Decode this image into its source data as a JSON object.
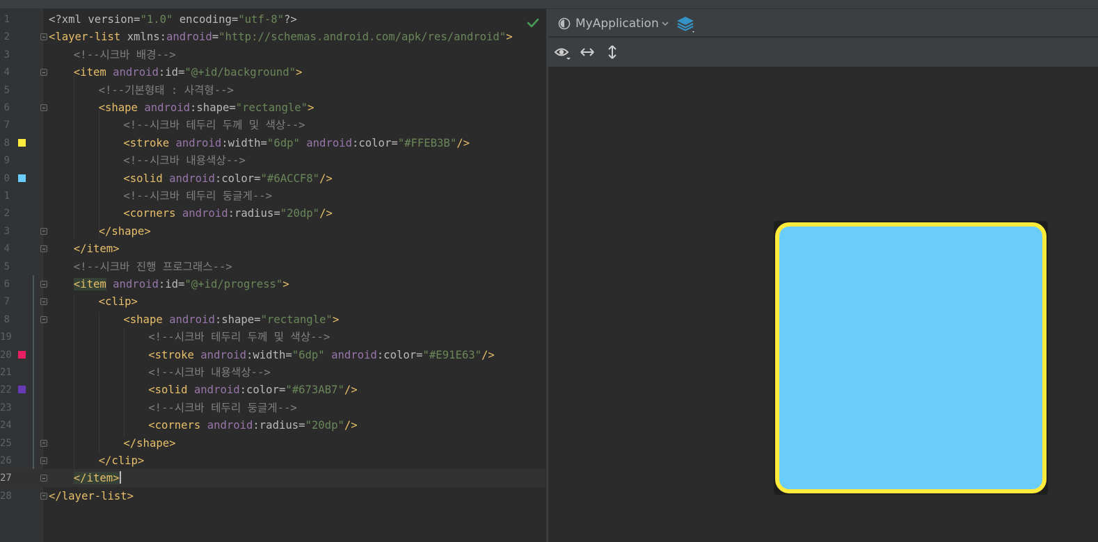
{
  "editor": {
    "lines": [
      {
        "n": "1",
        "tokens": [
          [
            "t-attr",
            "<?xml version="
          ],
          [
            "t-val",
            "\"1.0\""
          ],
          [
            "t-attr",
            " encoding="
          ],
          [
            "t-val",
            "\"utf-8\""
          ],
          [
            "t-attr",
            "?>"
          ]
        ]
      },
      {
        "n": "2",
        "tokens": [
          [
            "t-tag",
            "<layer-list "
          ],
          [
            "t-attr",
            "xmlns:"
          ],
          [
            "t-ns",
            "android"
          ],
          [
            "t-attr",
            "="
          ],
          [
            "t-val",
            "\"http://schemas.android.com/apk/res/android\""
          ],
          [
            "t-tag",
            ">"
          ]
        ]
      },
      {
        "n": "3",
        "tokens": [
          [
            "t-com",
            "<!--시크바 배경-->"
          ]
        ]
      },
      {
        "n": "4",
        "tokens": [
          [
            "t-tag",
            "<item "
          ],
          [
            "t-ns",
            "android"
          ],
          [
            "t-attr",
            ":id="
          ],
          [
            "t-val",
            "\"@+id/background\""
          ],
          [
            "t-tag",
            ">"
          ]
        ]
      },
      {
        "n": "5",
        "tokens": [
          [
            "t-com",
            "<!--기본형태 : 사격형-->"
          ]
        ]
      },
      {
        "n": "6",
        "tokens": [
          [
            "t-tag",
            "<shape "
          ],
          [
            "t-ns",
            "android"
          ],
          [
            "t-attr",
            ":shape="
          ],
          [
            "t-val",
            "\"rectangle\""
          ],
          [
            "t-tag",
            ">"
          ]
        ]
      },
      {
        "n": "7",
        "tokens": [
          [
            "t-com",
            "<!--시크바 테두리 두께 및 색상-->"
          ]
        ]
      },
      {
        "n": "8",
        "tokens": [
          [
            "t-tag",
            "<stroke "
          ],
          [
            "t-ns",
            "android"
          ],
          [
            "t-attr",
            ":width="
          ],
          [
            "t-val",
            "\"6dp\" "
          ],
          [
            "t-ns",
            "android"
          ],
          [
            "t-attr",
            ":color="
          ],
          [
            "t-val",
            "\"#FFEB3B\""
          ],
          [
            "t-tag",
            "/>"
          ]
        ]
      },
      {
        "n": "9",
        "tokens": [
          [
            "t-com",
            "<!--시크바 내용색상-->"
          ]
        ]
      },
      {
        "n": "0",
        "tokens": [
          [
            "t-tag",
            "<solid "
          ],
          [
            "t-ns",
            "android"
          ],
          [
            "t-attr",
            ":color="
          ],
          [
            "t-val",
            "\"#6ACCF8\""
          ],
          [
            "t-tag",
            "/>"
          ]
        ]
      },
      {
        "n": "1",
        "tokens": [
          [
            "t-com",
            "<!--시크바 테두리 둥글게-->"
          ]
        ]
      },
      {
        "n": "2",
        "tokens": [
          [
            "t-tag",
            "<corners "
          ],
          [
            "t-ns",
            "android"
          ],
          [
            "t-attr",
            ":radius="
          ],
          [
            "t-val",
            "\"20dp\""
          ],
          [
            "t-tag",
            "/>"
          ]
        ]
      },
      {
        "n": "3",
        "tokens": [
          [
            "t-tag",
            "</shape>"
          ]
        ]
      },
      {
        "n": "4",
        "tokens": [
          [
            "t-tag",
            "</item>"
          ]
        ]
      },
      {
        "n": "5",
        "tokens": [
          [
            "t-com",
            "<!--시크바 진행 프로그래스-->"
          ]
        ]
      },
      {
        "n": "6",
        "tokens": [
          [
            "t-tag t-hl",
            "<item"
          ],
          [
            "t-tag",
            " "
          ],
          [
            "t-ns",
            "android"
          ],
          [
            "t-attr",
            ":id="
          ],
          [
            "t-val",
            "\"@+id/progress\""
          ],
          [
            "t-tag",
            ">"
          ]
        ]
      },
      {
        "n": "7",
        "tokens": [
          [
            "t-tag",
            "<clip>"
          ]
        ]
      },
      {
        "n": "8",
        "tokens": [
          [
            "t-tag",
            "<shape "
          ],
          [
            "t-ns",
            "android"
          ],
          [
            "t-attr",
            ":shape="
          ],
          [
            "t-val",
            "\"rectangle\""
          ],
          [
            "t-tag",
            ">"
          ]
        ]
      },
      {
        "n": "19",
        "tokens": [
          [
            "t-com",
            "<!--시크바 테두리 두께 및 색상-->"
          ]
        ]
      },
      {
        "n": "20",
        "tokens": [
          [
            "t-tag",
            "<stroke "
          ],
          [
            "t-ns",
            "android"
          ],
          [
            "t-attr",
            ":width="
          ],
          [
            "t-val",
            "\"6dp\" "
          ],
          [
            "t-ns",
            "android"
          ],
          [
            "t-attr",
            ":color="
          ],
          [
            "t-val",
            "\"#E91E63\""
          ],
          [
            "t-tag",
            "/>"
          ]
        ]
      },
      {
        "n": "21",
        "tokens": [
          [
            "t-com",
            "<!--시크바 내용색상-->"
          ]
        ]
      },
      {
        "n": "22",
        "tokens": [
          [
            "t-tag",
            "<solid "
          ],
          [
            "t-ns",
            "android"
          ],
          [
            "t-attr",
            ":color="
          ],
          [
            "t-val",
            "\"#673AB7\""
          ],
          [
            "t-tag",
            "/>"
          ]
        ]
      },
      {
        "n": "23",
        "tokens": [
          [
            "t-com",
            "<!--시크바 테두리 둥글게-->"
          ]
        ]
      },
      {
        "n": "24",
        "tokens": [
          [
            "t-tag",
            "<corners "
          ],
          [
            "t-ns",
            "android"
          ],
          [
            "t-attr",
            ":radius="
          ],
          [
            "t-val",
            "\"20dp\""
          ],
          [
            "t-tag",
            "/>"
          ]
        ]
      },
      {
        "n": "25",
        "tokens": [
          [
            "t-tag",
            "</shape>"
          ]
        ]
      },
      {
        "n": "26",
        "tokens": [
          [
            "t-tag",
            "</clip>"
          ]
        ]
      },
      {
        "n": "27",
        "tokens": [
          [
            "t-tag t-hl",
            "</item>"
          ]
        ]
      },
      {
        "n": "28",
        "tokens": [
          [
            "t-tag",
            "</layer-list>"
          ]
        ]
      }
    ],
    "swatches": [
      {
        "line": 8,
        "color": "#FFEB3B"
      },
      {
        "line": 10,
        "color": "#6ACCF8"
      },
      {
        "line": 20,
        "color": "#E91E63"
      },
      {
        "line": 22,
        "color": "#673AB7"
      }
    ]
  },
  "preview": {
    "app_name": "MyApplication",
    "drawable_fill": "#6ACCF8",
    "drawable_stroke": "#FFEB3B"
  },
  "icons": [
    "check-icon",
    "theme-icon",
    "chevron-down-icon",
    "layers-icon",
    "eye-icon",
    "horizontal-resize-icon",
    "vertical-resize-icon"
  ]
}
